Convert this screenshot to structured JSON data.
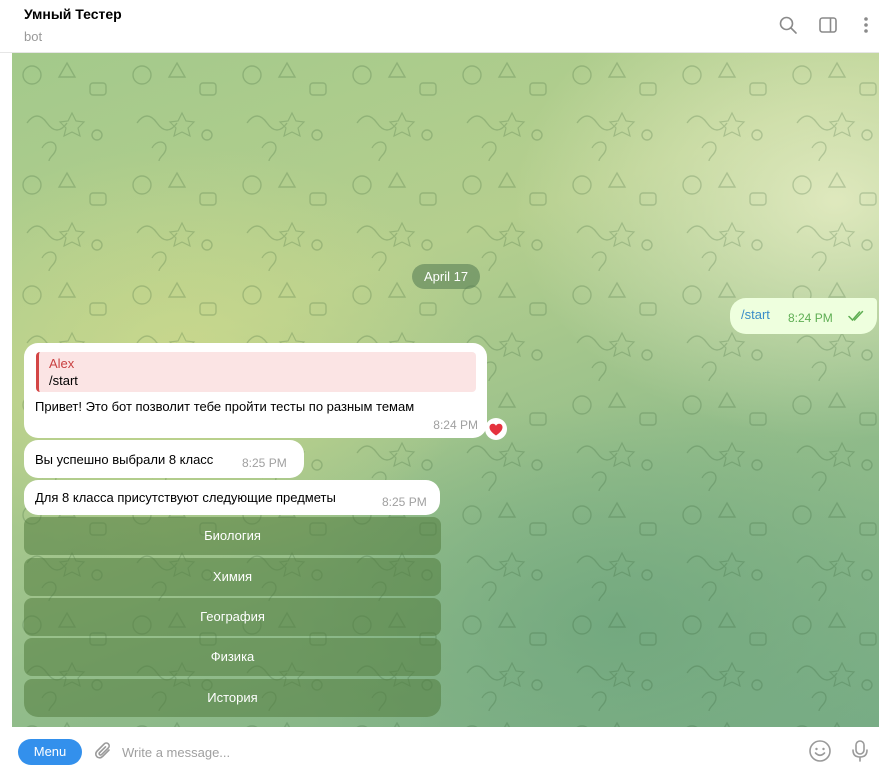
{
  "header": {
    "title": "Умный Тестер",
    "status": "bot",
    "icons": [
      "search-icon",
      "sidebar-toggle-icon",
      "more-vertical-icon"
    ]
  },
  "chat": {
    "date_separator": "April 17",
    "messages": [
      {
        "id": "start",
        "direction": "out",
        "text": "/start",
        "time": "8:24 PM",
        "status": "read"
      },
      {
        "id": "hello",
        "direction": "in",
        "reply_to": {
          "author": "Alex",
          "text": "/start"
        },
        "text": "Привет! Это бот позволит тебе пройти тесты по разным темам",
        "time": "8:24 PM",
        "reaction": "heart"
      },
      {
        "id": "class",
        "direction": "in",
        "text": "Вы успешно выбрали 8 класс",
        "time": "8:25 PM"
      },
      {
        "id": "subjects",
        "direction": "in",
        "text": "Для 8 класса присутствуют следующие предметы",
        "time": "8:25 PM"
      }
    ],
    "keyboard": [
      "Биология",
      "Химия",
      "География",
      "Физика",
      "История"
    ]
  },
  "composer": {
    "menu_label": "Menu",
    "placeholder": "Write a message...",
    "icons": [
      "paperclip-icon",
      "emoji-icon",
      "microphone-icon"
    ]
  },
  "colors": {
    "accent": "#3390ec",
    "out_bubble": "#eeffde",
    "reply_bar": "#d34545",
    "reaction": "#e5323e"
  }
}
